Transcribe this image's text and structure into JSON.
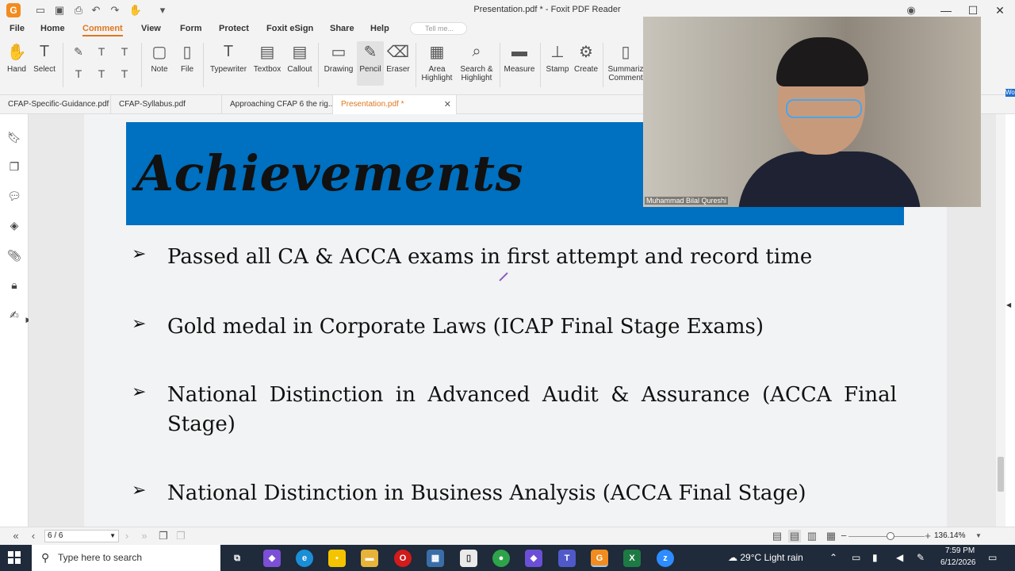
{
  "window": {
    "title": "Presentation.pdf * - Foxit PDF Reader",
    "logo": "G"
  },
  "menu": {
    "items": [
      "File",
      "Home",
      "Comment",
      "View",
      "Form",
      "Protect",
      "Foxit eSign",
      "Share",
      "Help"
    ],
    "active": "Comment",
    "tell_me_placeholder": "Tell me..."
  },
  "ribbon": {
    "hand": "Hand",
    "select": "Select",
    "note": "Note",
    "file": "File",
    "typewriter": "Typewriter",
    "textbox": "Textbox",
    "callout": "Callout",
    "drawing": "Drawing",
    "pencil": "Pencil",
    "eraser": "Eraser",
    "area_highlight_1": "Area",
    "area_highlight_2": "Highlight",
    "search_highlight_1": "Search &",
    "search_highlight_2": "Highlight",
    "measure": "Measure",
    "stamp": "Stamp",
    "create": "Create",
    "summarize_1": "Summariz",
    "summarize_2": "Comment"
  },
  "tabs": [
    {
      "label": "CFAP-Specific-Guidance.pdf"
    },
    {
      "label": "CFAP-Syllabus.pdf"
    },
    {
      "label": "Approaching CFAP 6 the rig..."
    },
    {
      "label": "Presentation.pdf *"
    }
  ],
  "slide": {
    "title": "Achievements",
    "bullets": [
      "Passed all CA & ACCA exams in first attempt and record time",
      "Gold medal in Corporate Laws (ICAP Final Stage Exams)",
      "National Distinction in Advanced Audit & Assurance (ACCA Final Stage)",
      "National Distinction in Business Analysis (ACCA Final Stage)"
    ],
    "bullet_glyph": "➢",
    "banner_color": "#0070c0"
  },
  "video": {
    "participant_name": "Muhammad Bilal Qureshi"
  },
  "right_badge": "Word",
  "status": {
    "page": "6 / 6",
    "zoom": "136.14%"
  },
  "taskbar": {
    "search_placeholder": "Type here to search",
    "weather": "29°C  Light rain",
    "time": "7:59 PM",
    "date": "6/12/2026"
  },
  "colors": {
    "accent": "#e0771d"
  }
}
